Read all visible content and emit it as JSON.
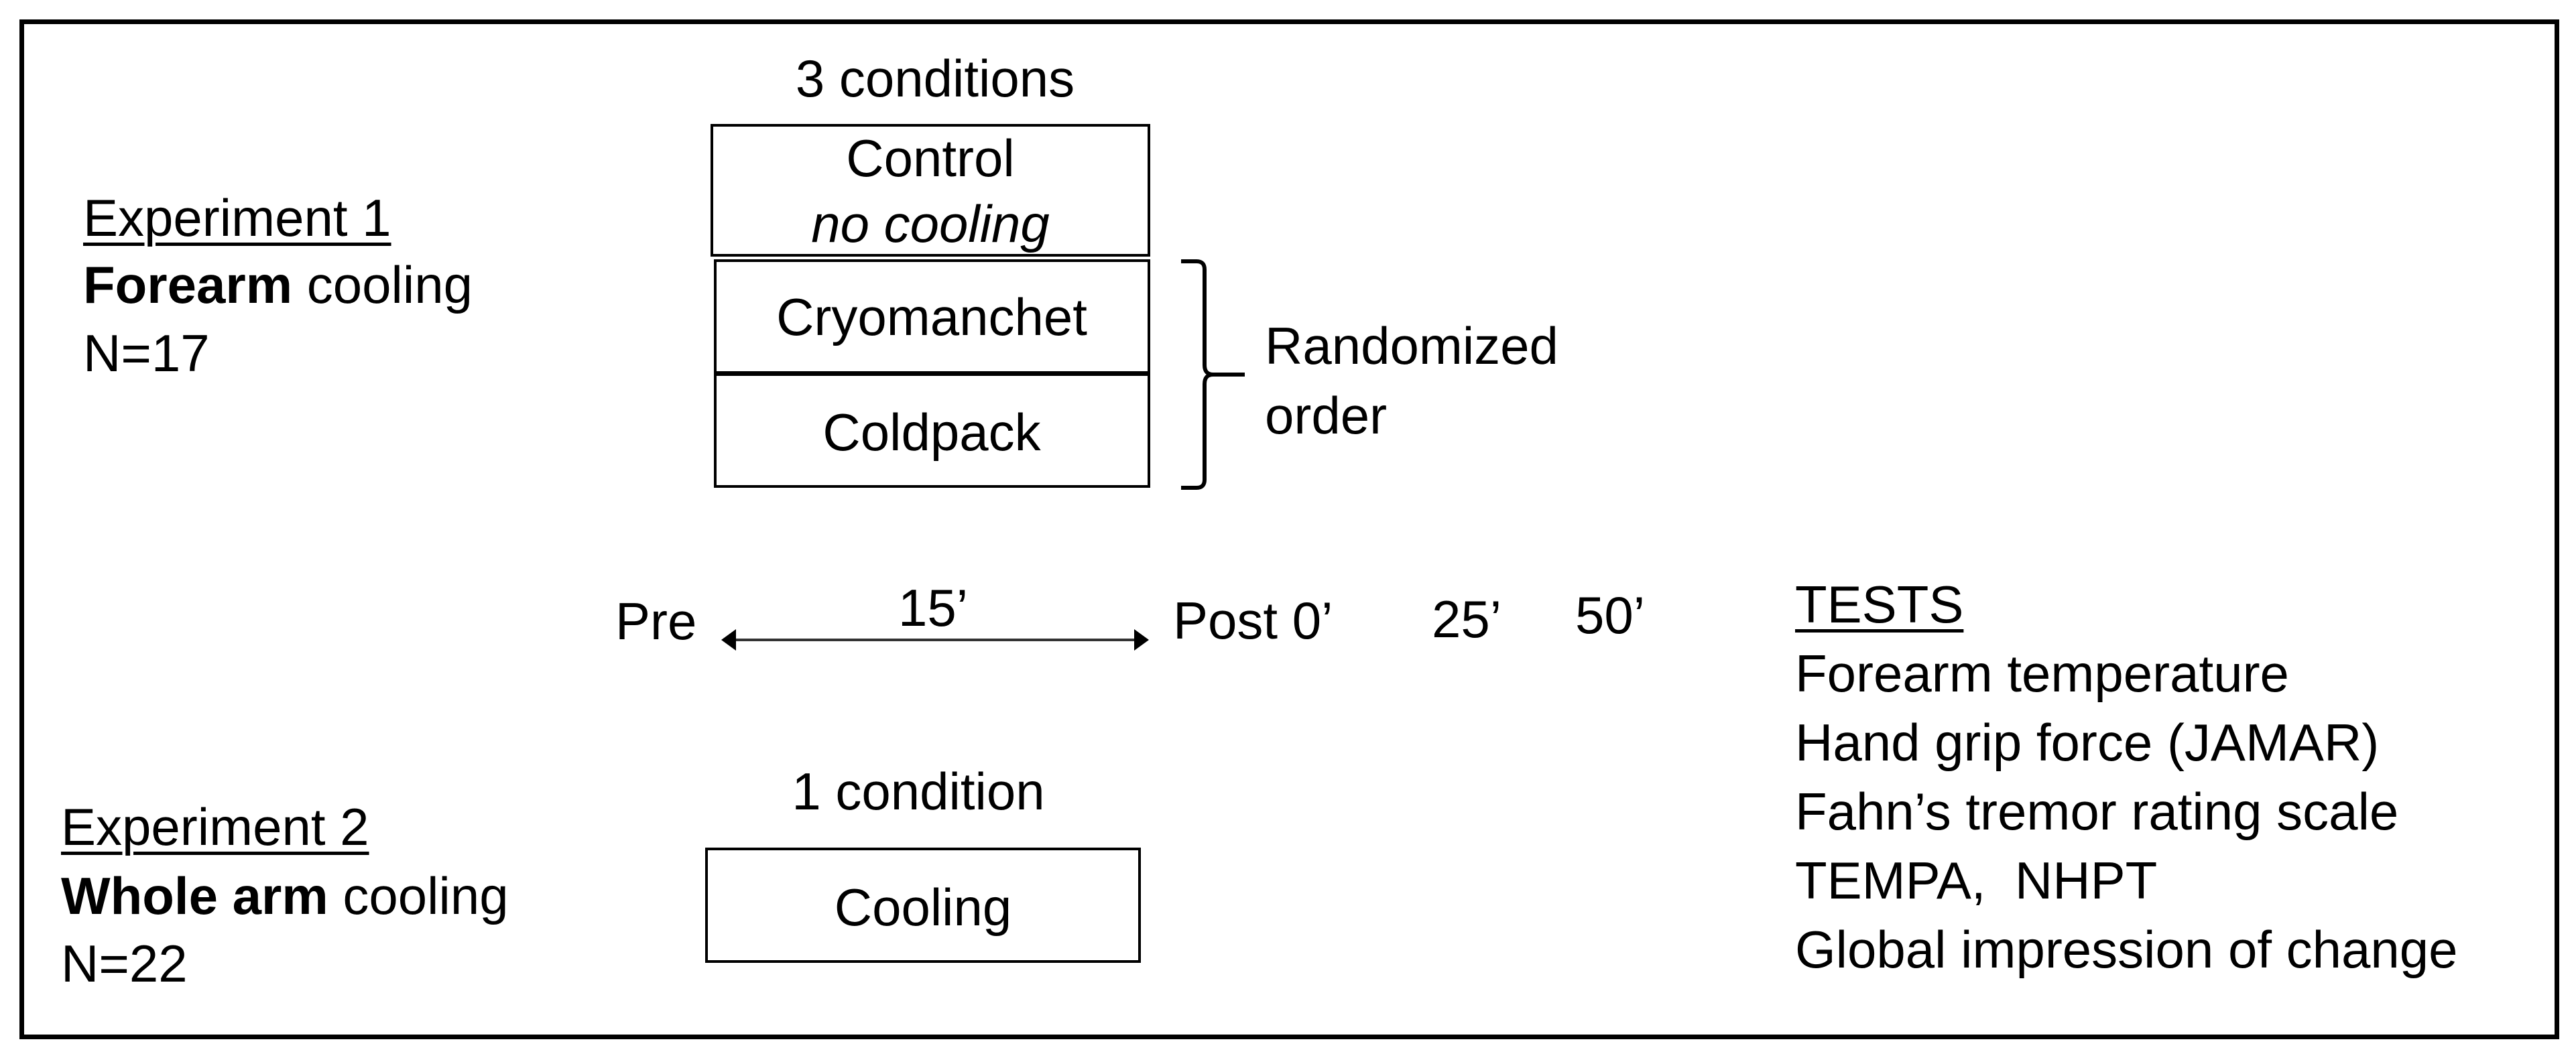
{
  "experiment1": {
    "title": "Experiment 1",
    "emphasis": "Forearm",
    "subtitle_rest": " cooling",
    "n": "N=17",
    "conditions_heading": "3 conditions",
    "conditions": [
      {
        "label": "Control",
        "sublabel": "no cooling"
      },
      {
        "label": "Cryomanchet"
      },
      {
        "label": "Coldpack"
      }
    ],
    "randomized_note": [
      "Randomized",
      "order"
    ]
  },
  "timeline": {
    "start": "Pre",
    "duration": "15’",
    "points": [
      "Post 0’",
      "25’",
      "50’"
    ]
  },
  "tests": {
    "heading": "TESTS",
    "items": [
      "Forearm temperature",
      "Hand grip force (JAMAR)",
      "Fahn’s tremor rating scale",
      "TEMPA,  NHPT",
      "Global impression of change"
    ]
  },
  "experiment2": {
    "title": "Experiment 2",
    "emphasis": "Whole arm",
    "subtitle_rest": " cooling",
    "n": "N=22",
    "conditions_heading": "1 condition",
    "conditions": [
      {
        "label": "Cooling"
      }
    ]
  }
}
